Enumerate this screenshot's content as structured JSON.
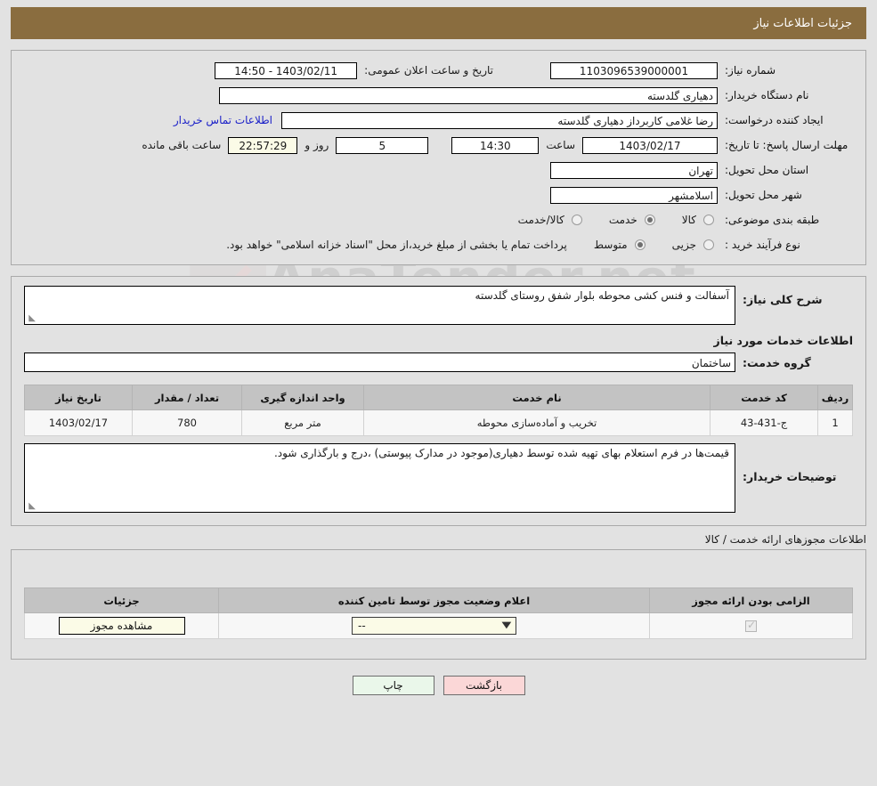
{
  "banner": {
    "title": "جزئیات اطلاعات نیاز"
  },
  "summary": {
    "need_number_label": "شماره نیاز:",
    "need_number_value": "1103096539000001",
    "announce_label": "تاریخ و ساعت اعلان عمومی:",
    "announce_value": "1403/02/11 - 14:50",
    "buyer_org_label": "نام دستگاه خریدار:",
    "buyer_org_value": "دهیاری گلدسته",
    "requester_label": "ایجاد کننده درخواست:",
    "requester_value": "رضا غلامی کاربرداز دهیاری گلدسته",
    "buyer_contact_link": "اطلاعات تماس خریدار",
    "deadline_label": "مهلت ارسال پاسخ: تا تاریخ:",
    "deadline_date": "1403/02/17",
    "deadline_hour_label": "ساعت",
    "deadline_hour_value": "14:30",
    "days_value": "5",
    "days_and_label": "روز و",
    "remaining_time": "22:57:29",
    "remaining_suffix": "ساعت باقی مانده",
    "province_label": "استان محل تحویل:",
    "province_value": "تهران",
    "city_label": "شهر محل تحویل:",
    "city_value": "اسلامشهر",
    "classification_label": "طبقه بندی موضوعی:",
    "classification_options": [
      {
        "label": "کالا",
        "selected": false
      },
      {
        "label": "خدمت",
        "selected": true
      },
      {
        "label": "کالا/خدمت",
        "selected": false
      }
    ],
    "process_label": "نوع فرآیند خرید :",
    "process_options": [
      {
        "label": "جزیی",
        "selected": false
      },
      {
        "label": "متوسط",
        "selected": true
      }
    ],
    "payment_note": "پرداخت تمام یا بخشی از مبلغ خرید،از محل \"اسناد خزانه اسلامی\" خواهد بود."
  },
  "details": {
    "general_desc_label": "شرح کلی نیاز:",
    "general_desc_value": "آسفالت و فنس کشی محوطه بلوار شفق روستای گلدسته",
    "services_section_title": "اطلاعات خدمات مورد نیاز",
    "service_group_label": "گروه خدمت:",
    "service_group_value": "ساختمان",
    "services_table": {
      "headers": [
        "ردیف",
        "کد خدمت",
        "نام خدمت",
        "واحد اندازه گیری",
        "تعداد / مقدار",
        "تاریخ نیاز"
      ],
      "rows": [
        [
          "1",
          "ج-431-43",
          "تخریب و آماده‌سازی محوطه",
          "متر مربع",
          "780",
          "1403/02/17"
        ]
      ]
    },
    "buyer_notes_label": "توضیحات خریدار:",
    "buyer_notes_value": "قیمت‌ها در فرم استعلام بهای تهیه شده توسط دهیاری(موجود در مدارک پیوستی) ،درج و بارگذاری شود."
  },
  "permits": {
    "section_label": "اطلاعات مجوزهای ارائه خدمت / کالا",
    "table": {
      "headers": [
        "الزامی بودن ارائه مجوز",
        "اعلام وضعیت مجوز توسط تامین کننده",
        "جزئیات"
      ],
      "rows": [
        {
          "required_checked": true,
          "status_value": "--",
          "details_button": "مشاهده مجوز"
        }
      ]
    }
  },
  "footer": {
    "print_label": "چاپ",
    "back_label": "بازگشت"
  },
  "watermark": {
    "text": "AnaTender.net"
  },
  "colors": {
    "banner_bg": "#8a6d3f",
    "page_bg": "#e2e2e2",
    "link": "#1b20c8",
    "cream_field": "#fbfbe7",
    "print_button": "#eaf7ea",
    "back_button": "#fbd7d7"
  }
}
